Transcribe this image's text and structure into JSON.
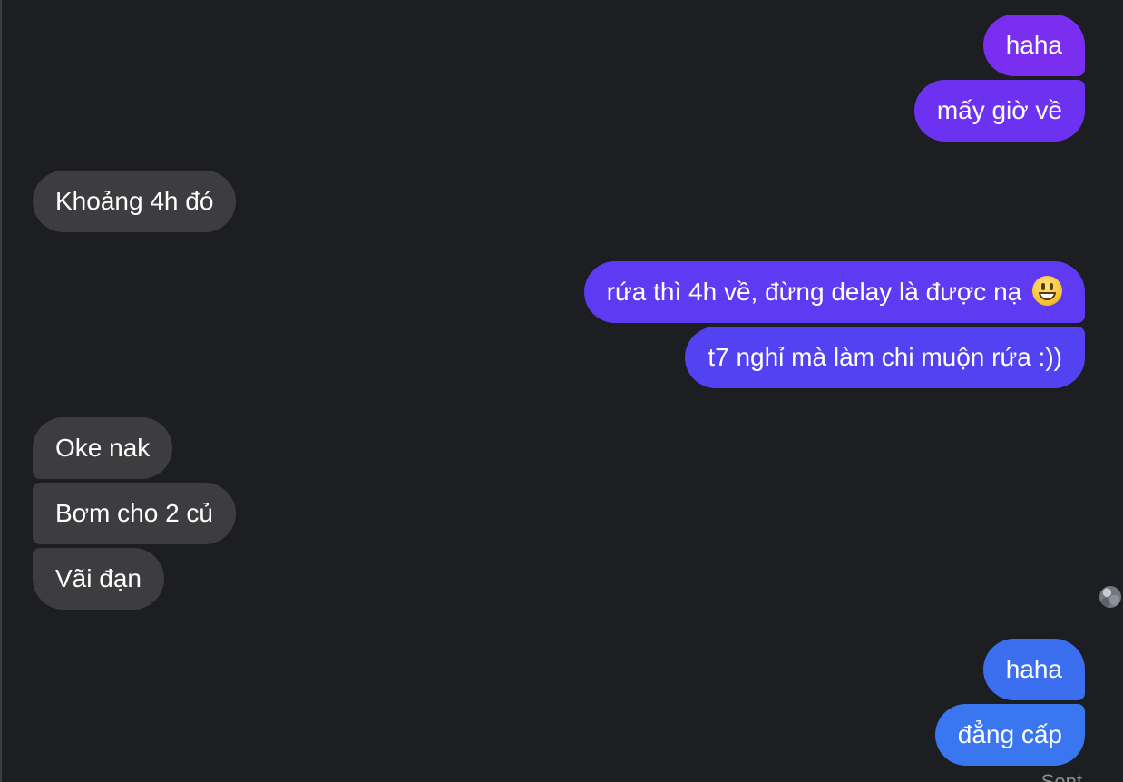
{
  "messages": {
    "m1": "haha",
    "m2": "mấy giờ về",
    "m3": "Khoảng 4h đó",
    "m4": "rứa thì 4h về, đừng delay là được nạ",
    "m5": "t7 nghỉ mà làm chi muộn rứa :))",
    "m6": "Oke nak",
    "m7": "Bơm cho 2 củ",
    "m8": "Vãi đạn",
    "m9": "haha",
    "m10": "đẳng cấp"
  },
  "status_text": "Sent",
  "colors": {
    "background": "#1d1e21",
    "incoming_bubble": "#3d3d40",
    "outgoing_purple": "#7a2ff0",
    "outgoing_violet": "#5a3cf2",
    "outgoing_blue": "#3a73ef"
  },
  "icons": {
    "emoji": "grinning-face-emoji",
    "avatar": "user-avatar"
  }
}
